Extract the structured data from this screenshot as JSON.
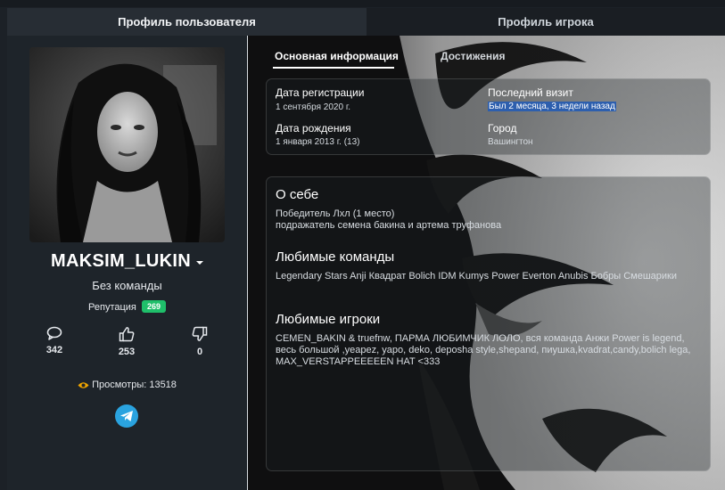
{
  "tabs": {
    "user_profile": "Профиль пользователя",
    "player_profile": "Профиль игрока"
  },
  "profile": {
    "username": "MAKSIM_LUKIN",
    "team": "Без команды",
    "reputation_label": "Репутация",
    "reputation_value": "269",
    "stats": {
      "comments": "342",
      "likes": "253",
      "dislikes": "0"
    },
    "views_text": "Просмотры: 13518"
  },
  "inner_tabs": {
    "main_info": "Основная информация",
    "achievements": "Достижения"
  },
  "info": {
    "registration_label": "Дата регистрации",
    "registration_value": "1 сентября 2020 г.",
    "birth_label": "Дата рождения",
    "birth_value": "1 января 2013 г. (13)",
    "last_visit_label": "Последний визит",
    "last_visit_value": "Был 2 месяца, 3 недели назад",
    "city_label": "Город",
    "city_value": "Вашингтон"
  },
  "about": {
    "title": "О себе",
    "lines": [
      "Победитель Лхл (1 место)",
      "подражатель семена бакина и артема труфанова"
    ]
  },
  "favorite_teams": {
    "title": "Любимые команды",
    "text": "Legendary Stars Anji Квадрат Bolich IDM Kumys Power Everton Anubis Бобры Смешарики"
  },
  "favorite_players": {
    "title": "Любимые игроки",
    "text": "CEMEN_BAKIN & truefnw, ПАРМА ЛЮБИМЧИК ЛОЛО, вся команда Анжи Power is legend, весь большой ,yeapez, yapo, deko, deposha style,shepand, пиушка,kvadrat,candy,bolich lega, MAX_VERSTAPPEEEEEN HAT <333"
  },
  "colors": {
    "background": "#1c2127",
    "panel": "#1e242a",
    "reputation_badge": "#1fbf6a",
    "telegram": "#2aa3df",
    "selection": "#2d5fae"
  },
  "icons": [
    "comment-icon",
    "thumbs-up-icon",
    "thumbs-down-icon",
    "eye-icon",
    "telegram-icon",
    "caret-down-icon"
  ]
}
